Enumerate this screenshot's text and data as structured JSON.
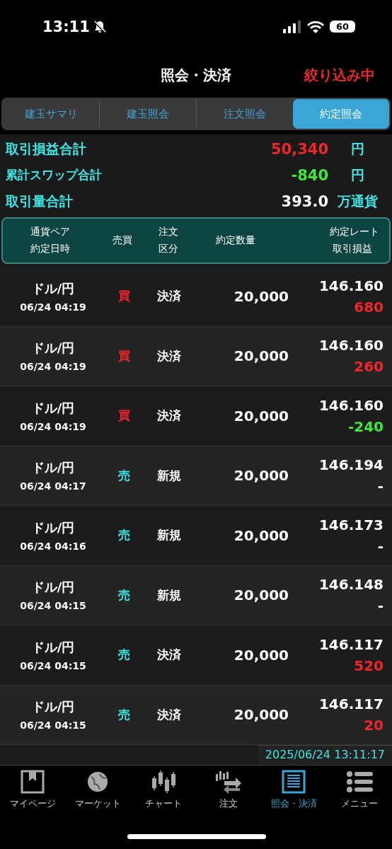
{
  "status_bar": {
    "time": "13:11",
    "battery": "60"
  },
  "header": {
    "title": "照会・決済",
    "filter": "絞り込み中"
  },
  "tabs": [
    {
      "label": "建玉サマリ",
      "selected": false
    },
    {
      "label": "建玉照会",
      "selected": false
    },
    {
      "label": "注文照会",
      "selected": false
    },
    {
      "label": "約定照会",
      "selected": true
    }
  ],
  "summary": [
    {
      "label": "取引損益合計",
      "value": "50,340",
      "unit": "円",
      "color": "#f0262b"
    },
    {
      "label": "累計スワップ合計",
      "value": "-840",
      "unit": "円",
      "color": "#3ee83a"
    },
    {
      "label": "取引量合計",
      "value": "393.0",
      "unit": "万通貨",
      "color": "#ffffff"
    }
  ],
  "columns": {
    "pair": "通貨ペア",
    "date": "約定日時",
    "side": "売買",
    "type_1": "注文",
    "type_2": "区分",
    "qty": "約定数量",
    "rate": "約定レート",
    "pnl": "取引損益"
  },
  "rows": [
    {
      "pair": "ドル/円",
      "date": "06/24 04:19",
      "side": "買",
      "kind": "buy",
      "type": "決済",
      "qty": "20,000",
      "rate": "146.160",
      "pnl": "680",
      "color": "#f0262b"
    },
    {
      "pair": "ドル/円",
      "date": "06/24 04:19",
      "side": "買",
      "kind": "buy",
      "type": "決済",
      "qty": "20,000",
      "rate": "146.160",
      "pnl": "260",
      "color": "#f0262b"
    },
    {
      "pair": "ドル/円",
      "date": "06/24 04:19",
      "side": "買",
      "kind": "buy",
      "type": "決済",
      "qty": "20,000",
      "rate": "146.160",
      "pnl": "-240",
      "color": "#3ee83a"
    },
    {
      "pair": "ドル/円",
      "date": "06/24 04:17",
      "side": "売",
      "kind": "sell",
      "type": "新規",
      "qty": "20,000",
      "rate": "146.194",
      "pnl": "-",
      "color": "#ffffff"
    },
    {
      "pair": "ドル/円",
      "date": "06/24 04:16",
      "side": "売",
      "kind": "sell",
      "type": "新規",
      "qty": "20,000",
      "rate": "146.173",
      "pnl": "-",
      "color": "#ffffff"
    },
    {
      "pair": "ドル/円",
      "date": "06/24 04:15",
      "side": "売",
      "kind": "sell",
      "type": "新規",
      "qty": "20,000",
      "rate": "146.148",
      "pnl": "-",
      "color": "#ffffff"
    },
    {
      "pair": "ドル/円",
      "date": "06/24 04:15",
      "side": "売",
      "kind": "sell",
      "type": "決済",
      "qty": "20,000",
      "rate": "146.117",
      "pnl": "520",
      "color": "#f0262b"
    },
    {
      "pair": "ドル/円",
      "date": "06/24 04:15",
      "side": "売",
      "kind": "sell",
      "type": "決済",
      "qty": "20,000",
      "rate": "146.117",
      "pnl": "20",
      "color": "#f0262b"
    }
  ],
  "timestamp": "2025/06/24 13:11:17",
  "nav": [
    {
      "label": "マイページ",
      "kind": "mypage",
      "selected": false
    },
    {
      "label": "マーケット",
      "kind": "market",
      "selected": false
    },
    {
      "label": "チャート",
      "kind": "chart",
      "selected": false
    },
    {
      "label": "注文",
      "kind": "order",
      "selected": false
    },
    {
      "label": "照会・決済",
      "kind": "inquiry",
      "selected": true
    },
    {
      "label": "メニュー",
      "kind": "menu",
      "selected": false
    }
  ]
}
